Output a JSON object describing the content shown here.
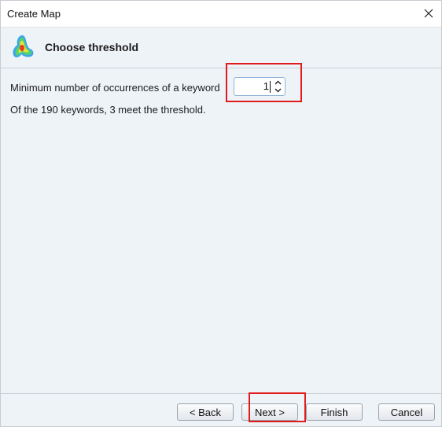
{
  "window": {
    "title": "Create Map"
  },
  "header": {
    "title": "Choose threshold",
    "icon": "vosviewer-logo-icon"
  },
  "threshold": {
    "label": "Minimum number of occurrences of a keyword",
    "value": "1"
  },
  "info_text": "Of the 190 keywords, 3 meet the threshold.",
  "buttons": {
    "back": "< Back",
    "next": "Next >",
    "finish": "Finish",
    "cancel": "Cancel"
  },
  "colors": {
    "highlight": "#e01b1b",
    "background": "#eef3f8"
  }
}
